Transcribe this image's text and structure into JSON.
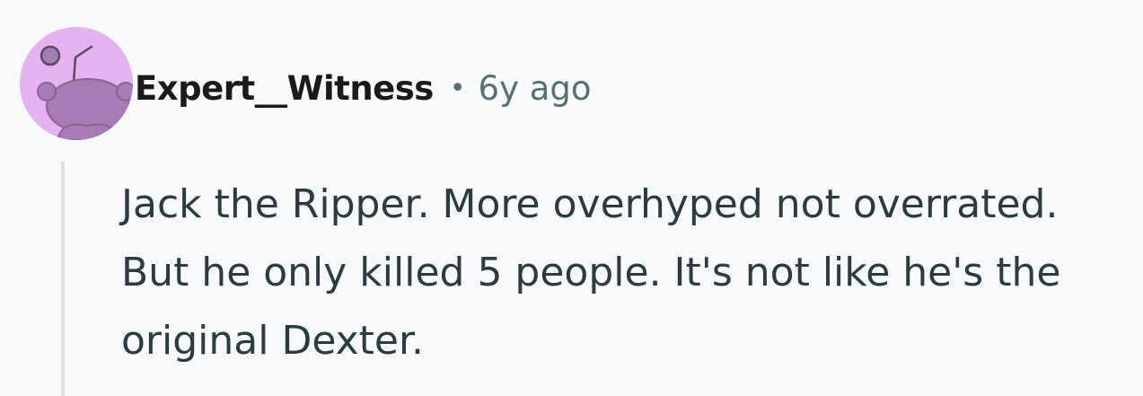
{
  "comment": {
    "username": "Expert__Witness",
    "separator": "•",
    "timestamp": "6y ago",
    "body": "Jack the Ripper. More overhyped not overrated. But he only killed 5 people. It's not like he's the original Dexter.",
    "avatar": {
      "icon": "snoo-avatar-icon",
      "background_color": "#e6b3f0",
      "figure_color": "#a77bb5"
    }
  },
  "colors": {
    "page_background": "#f8f9fa",
    "username": "#1a1a1b",
    "meta": "#576f76",
    "body_text": "#2a3c42",
    "thread_line": "#dbe2e8"
  }
}
